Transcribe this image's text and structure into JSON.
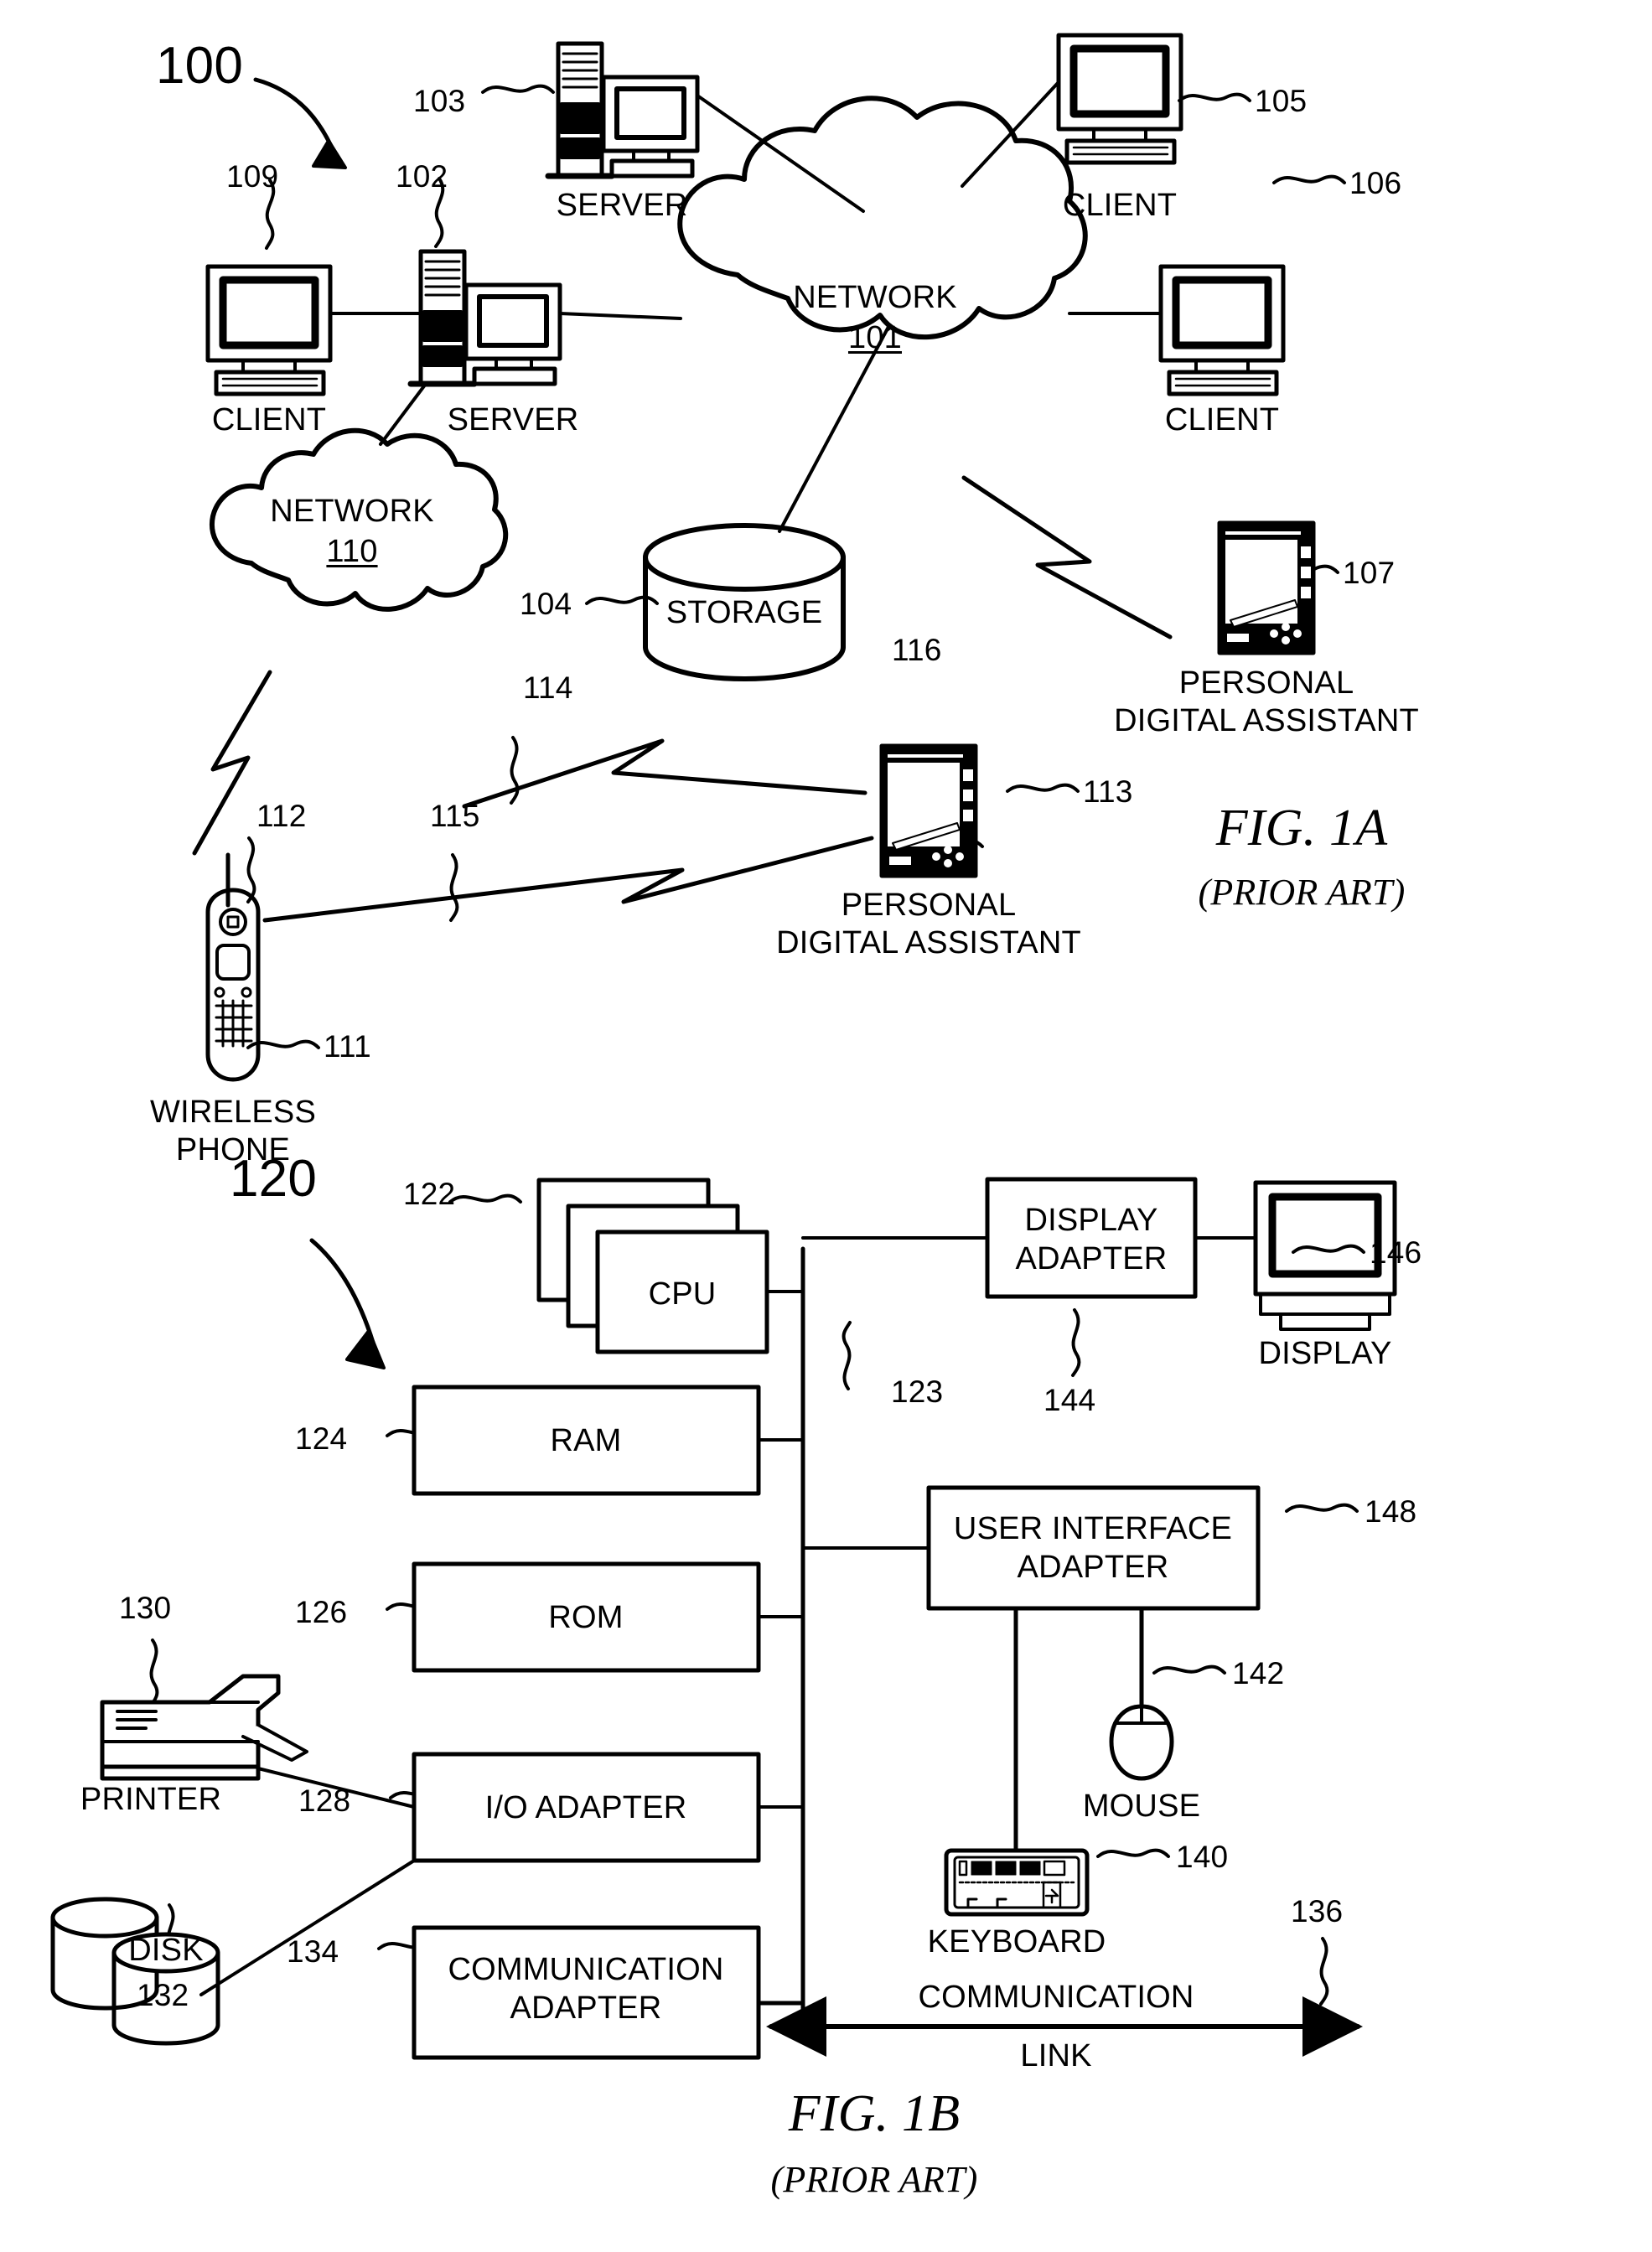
{
  "figures": [
    {
      "id": "fig-1a",
      "title": "FIG. 1A",
      "subtitle": "(PRIOR ART)",
      "system_ref": "100"
    },
    {
      "id": "fig-1b",
      "title": "FIG. 1B",
      "subtitle": "(PRIOR ART)",
      "system_ref": "120"
    }
  ],
  "fig1a": {
    "system_ref": "100",
    "nodes": {
      "client_109": {
        "label": "CLIENT",
        "ref": "109"
      },
      "server_102": {
        "label": "SERVER",
        "ref": "102"
      },
      "server_103": {
        "label": "SERVER",
        "ref": "103"
      },
      "client_105": {
        "label": "CLIENT",
        "ref": "105"
      },
      "client_106": {
        "label": "CLIENT",
        "ref": "106"
      },
      "network_101": {
        "label": "NETWORK",
        "ref": "101"
      },
      "network_110": {
        "label": "NETWORK",
        "ref": "110"
      },
      "storage_104": {
        "label": "STORAGE",
        "ref": "104"
      },
      "pda_107": {
        "label_line1": "PERSONAL",
        "label_line2": "DIGITAL ASSISTANT",
        "ref": "107"
      },
      "pda_113": {
        "label_line1": "PERSONAL",
        "label_line2": "DIGITAL ASSISTANT",
        "ref": "113"
      },
      "phone_111": {
        "label_line1": "WIRELESS",
        "label_line2": "PHONE",
        "ref": "111"
      }
    },
    "wireless_links": [
      {
        "ref": "112"
      },
      {
        "ref": "114"
      },
      {
        "ref": "115"
      },
      {
        "ref": "116"
      }
    ]
  },
  "fig1b": {
    "system_ref": "120",
    "blocks": {
      "cpu": {
        "label": "CPU",
        "ref": "122"
      },
      "bus": {
        "ref": "123"
      },
      "ram": {
        "label": "RAM",
        "ref": "124"
      },
      "rom": {
        "label": "ROM",
        "ref": "126"
      },
      "io_adapter": {
        "label": "I/O ADAPTER",
        "ref": "128"
      },
      "communication_adapter": {
        "label_line1": "COMMUNICATION",
        "label_line2": "ADAPTER",
        "ref": "134"
      },
      "display_adapter": {
        "label_line1": "DISPLAY",
        "label_line2": "ADAPTER",
        "ref": "144"
      },
      "user_interface_adapter": {
        "label_line1": "USER INTERFACE",
        "label_line2": "ADAPTER",
        "ref": "148"
      }
    },
    "peripherals": {
      "printer": {
        "label": "PRINTER",
        "ref": "130"
      },
      "disk": {
        "label": "DISK",
        "ref": "132"
      },
      "display": {
        "label": "DISPLAY",
        "ref": "146"
      },
      "mouse": {
        "label": "MOUSE",
        "ref": "142"
      },
      "keyboard": {
        "label": "KEYBOARD",
        "ref": "140"
      }
    },
    "communication_link": {
      "label_line1": "COMMUNICATION",
      "label_line2": "LINK",
      "ref": "136"
    }
  }
}
